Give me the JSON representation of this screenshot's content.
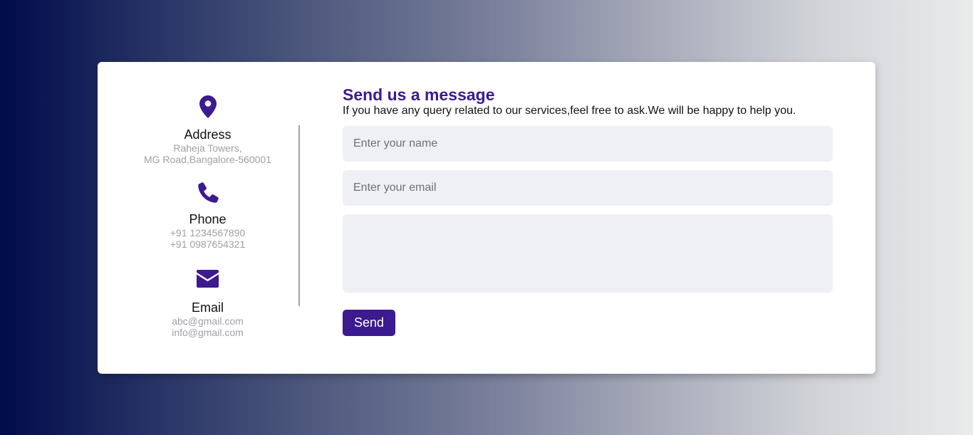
{
  "contact": {
    "address": {
      "icon": "map-pin-icon",
      "title": "Address",
      "lines": [
        "Raheja Towers,",
        "MG Road,Bangalore-560001"
      ]
    },
    "phone": {
      "icon": "phone-icon",
      "title": "Phone",
      "lines": [
        "+91 1234567890",
        "+91 0987654321"
      ]
    },
    "email": {
      "icon": "envelope-icon",
      "title": "Email",
      "lines": [
        "abc@gmail.com",
        "info@gmail.com"
      ]
    }
  },
  "form": {
    "heading": "Send us a message",
    "subtext": "If you have any query related to our services,feel free to ask.We will be happy to help you.",
    "name_placeholder": "Enter your name",
    "email_placeholder": "Enter your email",
    "message_placeholder": "",
    "send_label": "Send"
  },
  "colors": {
    "accent": "#3c1a8f",
    "input_bg": "#eff0f6",
    "muted_text": "#a0a0a6"
  }
}
